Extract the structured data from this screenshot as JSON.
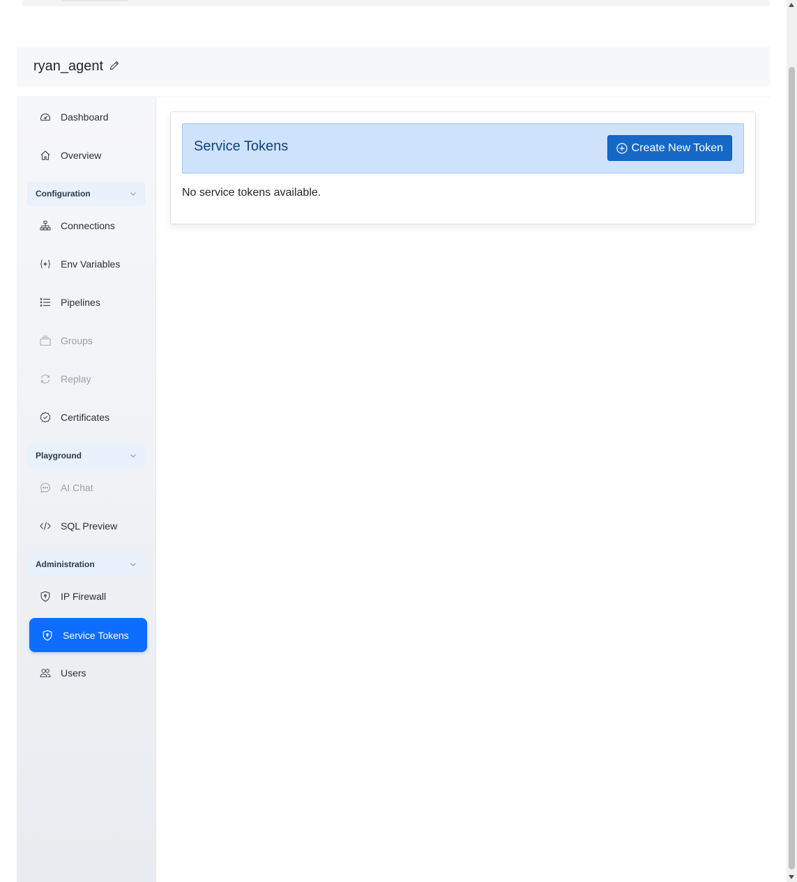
{
  "header": {
    "title": "ryan_agent",
    "edit_icon": "pencil-icon"
  },
  "sidebar": {
    "items_top": [
      {
        "label": "Dashboard",
        "icon": "speedometer-icon"
      },
      {
        "label": "Overview",
        "icon": "home-icon"
      }
    ],
    "configuration": {
      "label": "Configuration",
      "items": [
        {
          "label": "Connections",
          "icon": "diagram-icon"
        },
        {
          "label": "Env Variables",
          "icon": "braces-asterisk-icon"
        },
        {
          "label": "Pipelines",
          "icon": "list-icon"
        },
        {
          "label": "Groups",
          "icon": "collection-icon",
          "disabled": true
        },
        {
          "label": "Replay",
          "icon": "refresh-icon",
          "disabled": true
        },
        {
          "label": "Certificates",
          "icon": "patch-check-icon"
        }
      ]
    },
    "playground": {
      "label": "Playground",
      "items": [
        {
          "label": "AI Chat",
          "icon": "chat-dots-icon",
          "disabled": true
        },
        {
          "label": "SQL Preview",
          "icon": "code-slash-icon"
        }
      ]
    },
    "administration": {
      "label": "Administration",
      "items": [
        {
          "label": "IP Firewall",
          "icon": "shield-icon"
        },
        {
          "label": "Service Tokens",
          "icon": "shield-lock-icon",
          "active": true
        },
        {
          "label": "Users",
          "icon": "people-icon"
        }
      ]
    }
  },
  "main": {
    "card_title": "Service Tokens",
    "create_button": "Create New Token",
    "create_button_icon": "plus-circle-icon",
    "empty_message": "No service tokens available."
  },
  "colors": {
    "accent": "#0d6efd",
    "card_header_bg": "#cfe2fc",
    "button_bg": "#1668c7",
    "section_head_bg": "#e8f1fc"
  }
}
